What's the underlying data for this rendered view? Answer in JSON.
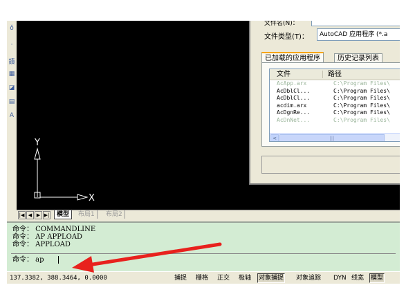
{
  "toolbar": {
    "icons": [
      "line-icon",
      "dot-icon",
      "hatch-icon",
      "table-icon",
      "region-icon",
      "grid-icon",
      "text-icon"
    ],
    "glyphs": [
      "ǒ",
      "·",
      "䥊",
      "▦",
      "◪",
      "▤",
      "A"
    ]
  },
  "drawing": {
    "ucs_x_label": "X",
    "ucs_y_label": "Y"
  },
  "layout_tabs": {
    "nav": [
      "|◀",
      "◀",
      "▶",
      "▶|"
    ],
    "model": "模型",
    "layout1": "布局1",
    "layout2": "布局2"
  },
  "command": {
    "history": [
      "命令： COMMANDLINE",
      "命令： AP APPLOAD",
      "命令： APPLOAD"
    ],
    "input": "命令： ap"
  },
  "status": {
    "coords": "137.3382,  388.3464,  0.0000",
    "buttons": [
      {
        "label": "捕捉",
        "on": false
      },
      {
        "label": "栅格",
        "on": false
      },
      {
        "label": "正交",
        "on": false
      },
      {
        "label": "极轴",
        "on": false
      },
      {
        "label": "对象捕捉",
        "on": true
      },
      {
        "label": "对象追踪",
        "on": false
      },
      {
        "label": "DYN",
        "on": false
      },
      {
        "label": "线宽",
        "on": false
      },
      {
        "label": "模型",
        "on": true
      }
    ]
  },
  "dialog": {
    "top_label": "文件名(N)：",
    "file_type_label": "文件类型(T)：",
    "file_type_value": "AutoCAD 应用程序 (*.a",
    "tabs": {
      "loaded": "已加载的应用程序",
      "history": "历史记录列表"
    },
    "columns": {
      "file": "文件",
      "path": "路径"
    },
    "rows": [
      {
        "file": "AcApp.arx",
        "path": "C:\\Program Files\\",
        "faded": true
      },
      {
        "file": "AcDblCl...",
        "path": "C:\\Program Files\\",
        "faded": false
      },
      {
        "file": "AcDblCl...",
        "path": "C:\\Program Files\\",
        "faded": false
      },
      {
        "file": "acdim.arx",
        "path": "C:\\Program Files\\",
        "faded": false
      },
      {
        "file": "AcDgnRe...",
        "path": "C:\\Program Files\\",
        "faded": false
      },
      {
        "file": "AcDnNet...",
        "path": "C:\\Program Files\\",
        "faded": true
      }
    ],
    "scroll_left": "<",
    "scroll_thumb": "|||"
  },
  "annotation": {
    "arrow_color": "#e8211d"
  }
}
